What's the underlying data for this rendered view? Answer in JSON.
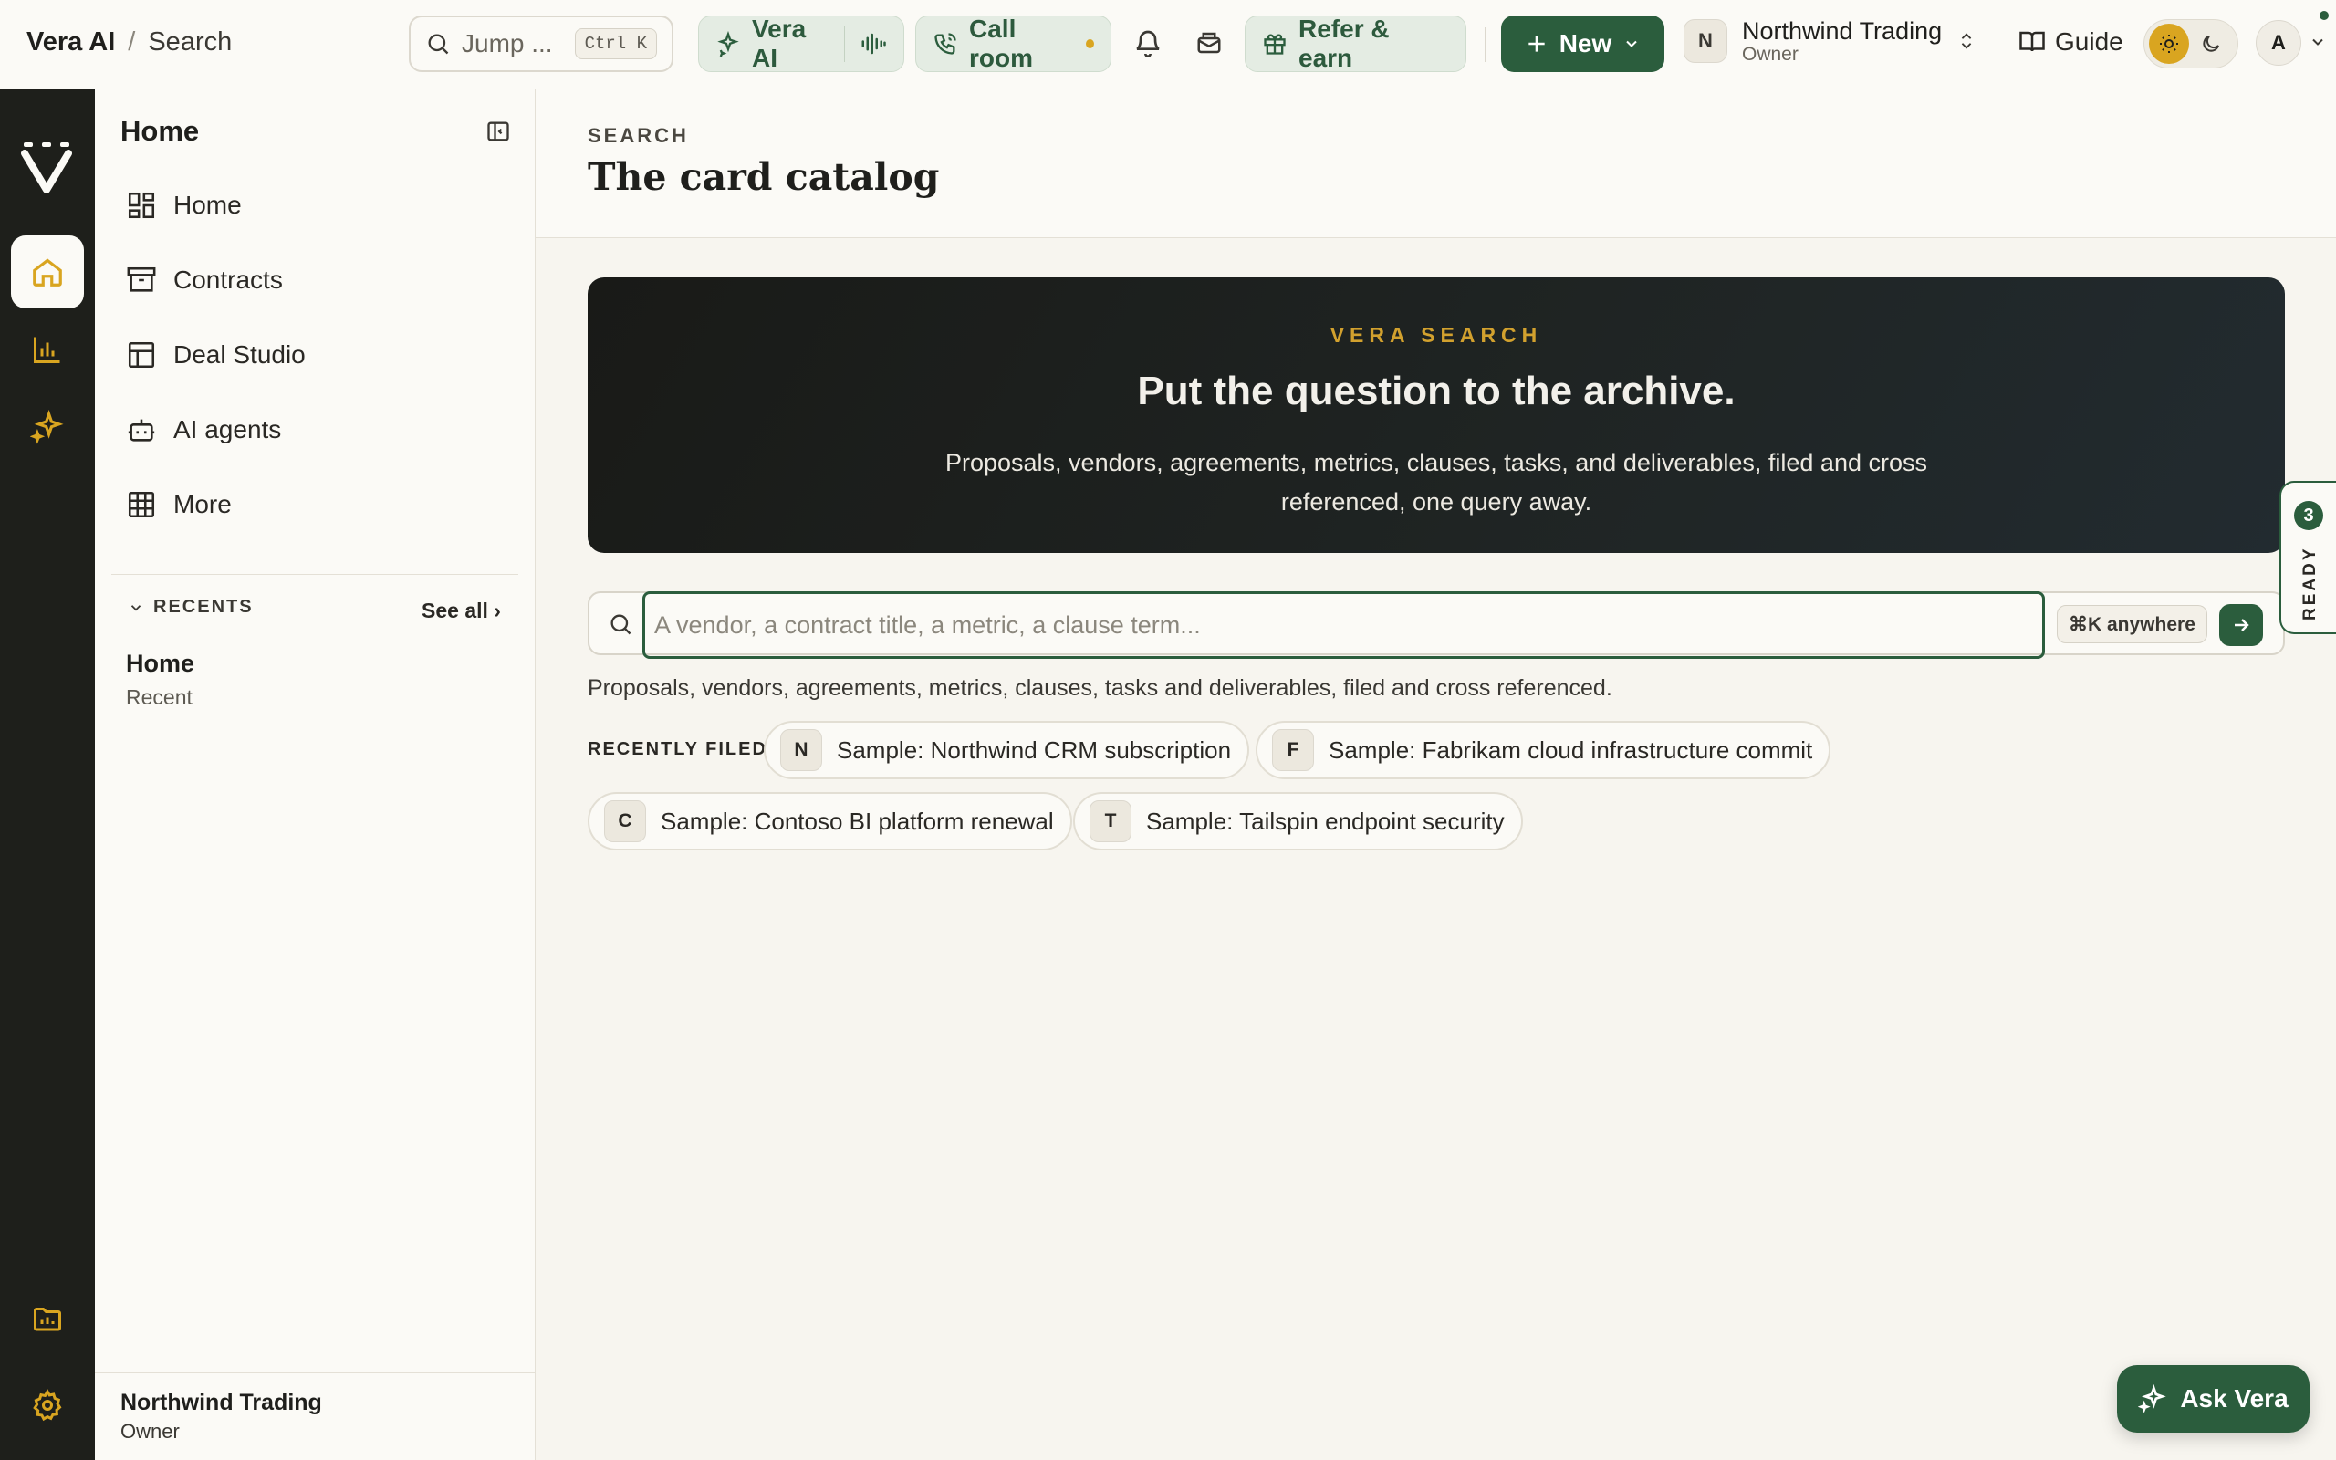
{
  "breadcrumb": {
    "app": "Vera AI",
    "separator": "/",
    "current": "Search"
  },
  "topbar": {
    "jump_label": "Jump ...",
    "jump_shortcut": "Ctrl K",
    "vera_ai_label": "Vera AI",
    "call_room_label": "Call room",
    "refer_label": "Refer & earn",
    "new_label": "New",
    "org_initial": "N",
    "org_name": "Northwind Trading",
    "org_role": "Owner",
    "guide_label": "Guide",
    "user_initial": "A"
  },
  "sidebar": {
    "title": "Home",
    "items": [
      {
        "label": "Home",
        "icon": "dashboard-icon"
      },
      {
        "label": "Contracts",
        "icon": "archive-icon"
      },
      {
        "label": "Deal Studio",
        "icon": "layout-icon"
      },
      {
        "label": "AI agents",
        "icon": "bot-icon"
      },
      {
        "label": "More",
        "icon": "grid-icon"
      }
    ],
    "recents_heading": "RECENTS",
    "see_all": "See all ›",
    "recents": [
      {
        "title": "Home",
        "subtitle": "Recent"
      }
    ],
    "footer": {
      "name": "Northwind Trading",
      "role": "Owner"
    }
  },
  "main": {
    "eyebrow": "SEARCH",
    "title": "The card catalog",
    "hero": {
      "eyebrow": "VERA SEARCH",
      "title": "Put the question to the archive.",
      "description": "Proposals, vendors, agreements, metrics, clauses, tasks, and deliverables, filed and cross referenced, one query away."
    },
    "search": {
      "placeholder": "A vendor, a contract title, a metric, a clause term...",
      "value": "",
      "shortcut": "⌘K anywhere"
    },
    "helper": "Proposals, vendors, agreements, metrics, clauses, tasks and deliverables, filed and cross referenced.",
    "recently_filed_label": "RECENTLY FILED",
    "recently_filed": [
      {
        "initial": "N",
        "label": "Sample: Northwind CRM subscription"
      },
      {
        "initial": "F",
        "label": "Sample: Fabrikam cloud infrastructure commit"
      },
      {
        "initial": "C",
        "label": "Sample: Contoso BI platform renewal"
      },
      {
        "initial": "T",
        "label": "Sample: Tailspin endpoint security"
      }
    ]
  },
  "ready_tab": {
    "count": "3",
    "label": "READY"
  },
  "ask_vera_label": "Ask Vera",
  "colors": {
    "brand_green": "#2b5d3d",
    "accent_gold": "#d9a520",
    "rail_dark": "#1e1f1b"
  }
}
